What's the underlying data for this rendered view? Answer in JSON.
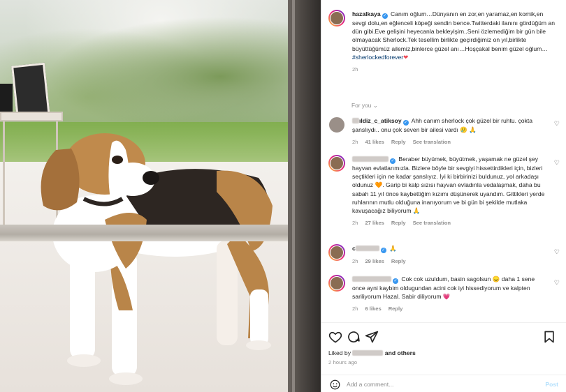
{
  "post": {
    "caption": {
      "username": "hazalkaya",
      "text": "Canım oğlum…Dünyanın en zor,en yaramaz,en komik,en sevgi dolu,en eğlenceli köpeği sendin bence.Twitterdaki ilanını gördüğüm an dün gibi.Eve gelişini heyecanla bekleyişim..Seni özlemediğim bir gün bile olmayacak Sherlock.Tek tesellim birlikte geçirdiğimiz on yıl,birlikte büyüttüğümüz ailemiz,binlerce güzel anı…Hoşçakal benim güzel oğlum…",
      "hashtag": "#sherlockedforever",
      "time": "2h"
    },
    "for_you_label": "For you",
    "comments": [
      {
        "username": "ıldiz_c_atiksoy",
        "text": "Ahh canım sherlock çok güzel bir ruhtu. çokta şanslıydı.. onu çok seven bir ailesi vardı 🥲 🙏",
        "time": "2h",
        "likes": "41 likes",
        "reply": "Reply",
        "translation": "See translation"
      },
      {
        "username": "",
        "text": "Beraber büyümek, büyütmek, yaşamak ne güzel şey hayvan evlatlarımızla. Bizlere böyle bir sevgiyi hissettirdikleri için, bizleri seçtikleri için ne kadar şanslıyız. İyi ki birbirinizi buldunuz, yol arkadaşı oldunuz 🧡. Garip bi kalp sızısı hayvan evladınla vedalaşmak, daha bu sabah 11 yıl önce kaybettiğim kızımı düşünerek uyandım. Gittikleri yerde ruhlarının mutlu olduğuna inanıyorum ve bi gün bi şekilde mutlaka kavuşacağız biliyorum 🙏",
        "time": "2h",
        "likes": "27 likes",
        "reply": "Reply",
        "translation": "See translation"
      },
      {
        "username": "c",
        "text": "🙏",
        "time": "2h",
        "likes": "29 likes",
        "reply": "Reply",
        "translation": ""
      },
      {
        "username": "",
        "text": "Cok cok uzuldum, basin sagolsun 😞 daha 1 sene once ayni kaybim oldugundan acini cok iyi hissediyorum ve kalpten sariliyorum Hazal. Sabir diliyorum 💗",
        "time": "2h",
        "likes": "6 likes",
        "reply": "Reply",
        "translation": ""
      }
    ],
    "liked_by_label": "Liked by",
    "and_others": "and others",
    "posted_ago": "2 hours ago",
    "add_comment_placeholder": "Add a comment...",
    "post_button": "Post"
  },
  "colors": {
    "link": "#00376b",
    "verified": "#3897f0",
    "muted": "#8e8e8e",
    "post_disabled": "#b2dffc"
  },
  "icons": [
    "heart-icon",
    "comment-icon",
    "share-icon",
    "bookmark-icon",
    "emoji-icon",
    "verified-icon",
    "chevron-down-icon"
  ]
}
